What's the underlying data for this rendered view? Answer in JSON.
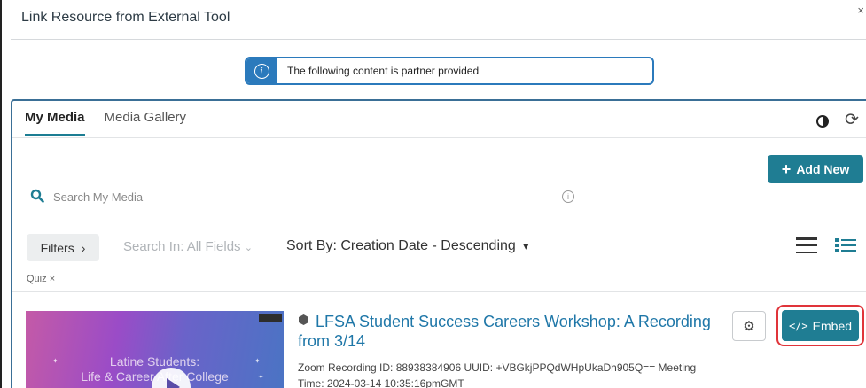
{
  "dialog": {
    "title": "Link Resource from External Tool"
  },
  "notice": {
    "icon": "info-icon",
    "text": "The following content is partner provided"
  },
  "tabs": [
    {
      "label": "My Media",
      "active": true
    },
    {
      "label": "Media Gallery",
      "active": false
    }
  ],
  "toolbar": {
    "contrast_icon": "contrast-icon",
    "refresh_icon": "refresh-icon",
    "add_new_label": "Add New"
  },
  "search": {
    "placeholder": "Search My Media"
  },
  "filters": {
    "filters_label": "Filters",
    "search_in_label": "Search In: All Fields",
    "sort_by_label": "Sort By: Creation Date - Descending",
    "active_chip": "Quiz"
  },
  "entries": [
    {
      "title": "LFSA Student Success Careers Workshop: A Recording from 3/14",
      "description": "Zoom Recording ID: 88938384906 UUID: +VBGkjPPQdWHpUkaDh905Q== Meeting Time: 2024-03-14 10:35:16pmGMT",
      "thumbnail_text_line1": "Latine Students:",
      "thumbnail_text_line2": "Life & Career After College",
      "embed_label": "Embed"
    }
  ],
  "colors": {
    "accent": "#1f7d93",
    "notice_border": "#2b7abc",
    "link": "#1f77a8",
    "highlight": "#e0343a"
  }
}
